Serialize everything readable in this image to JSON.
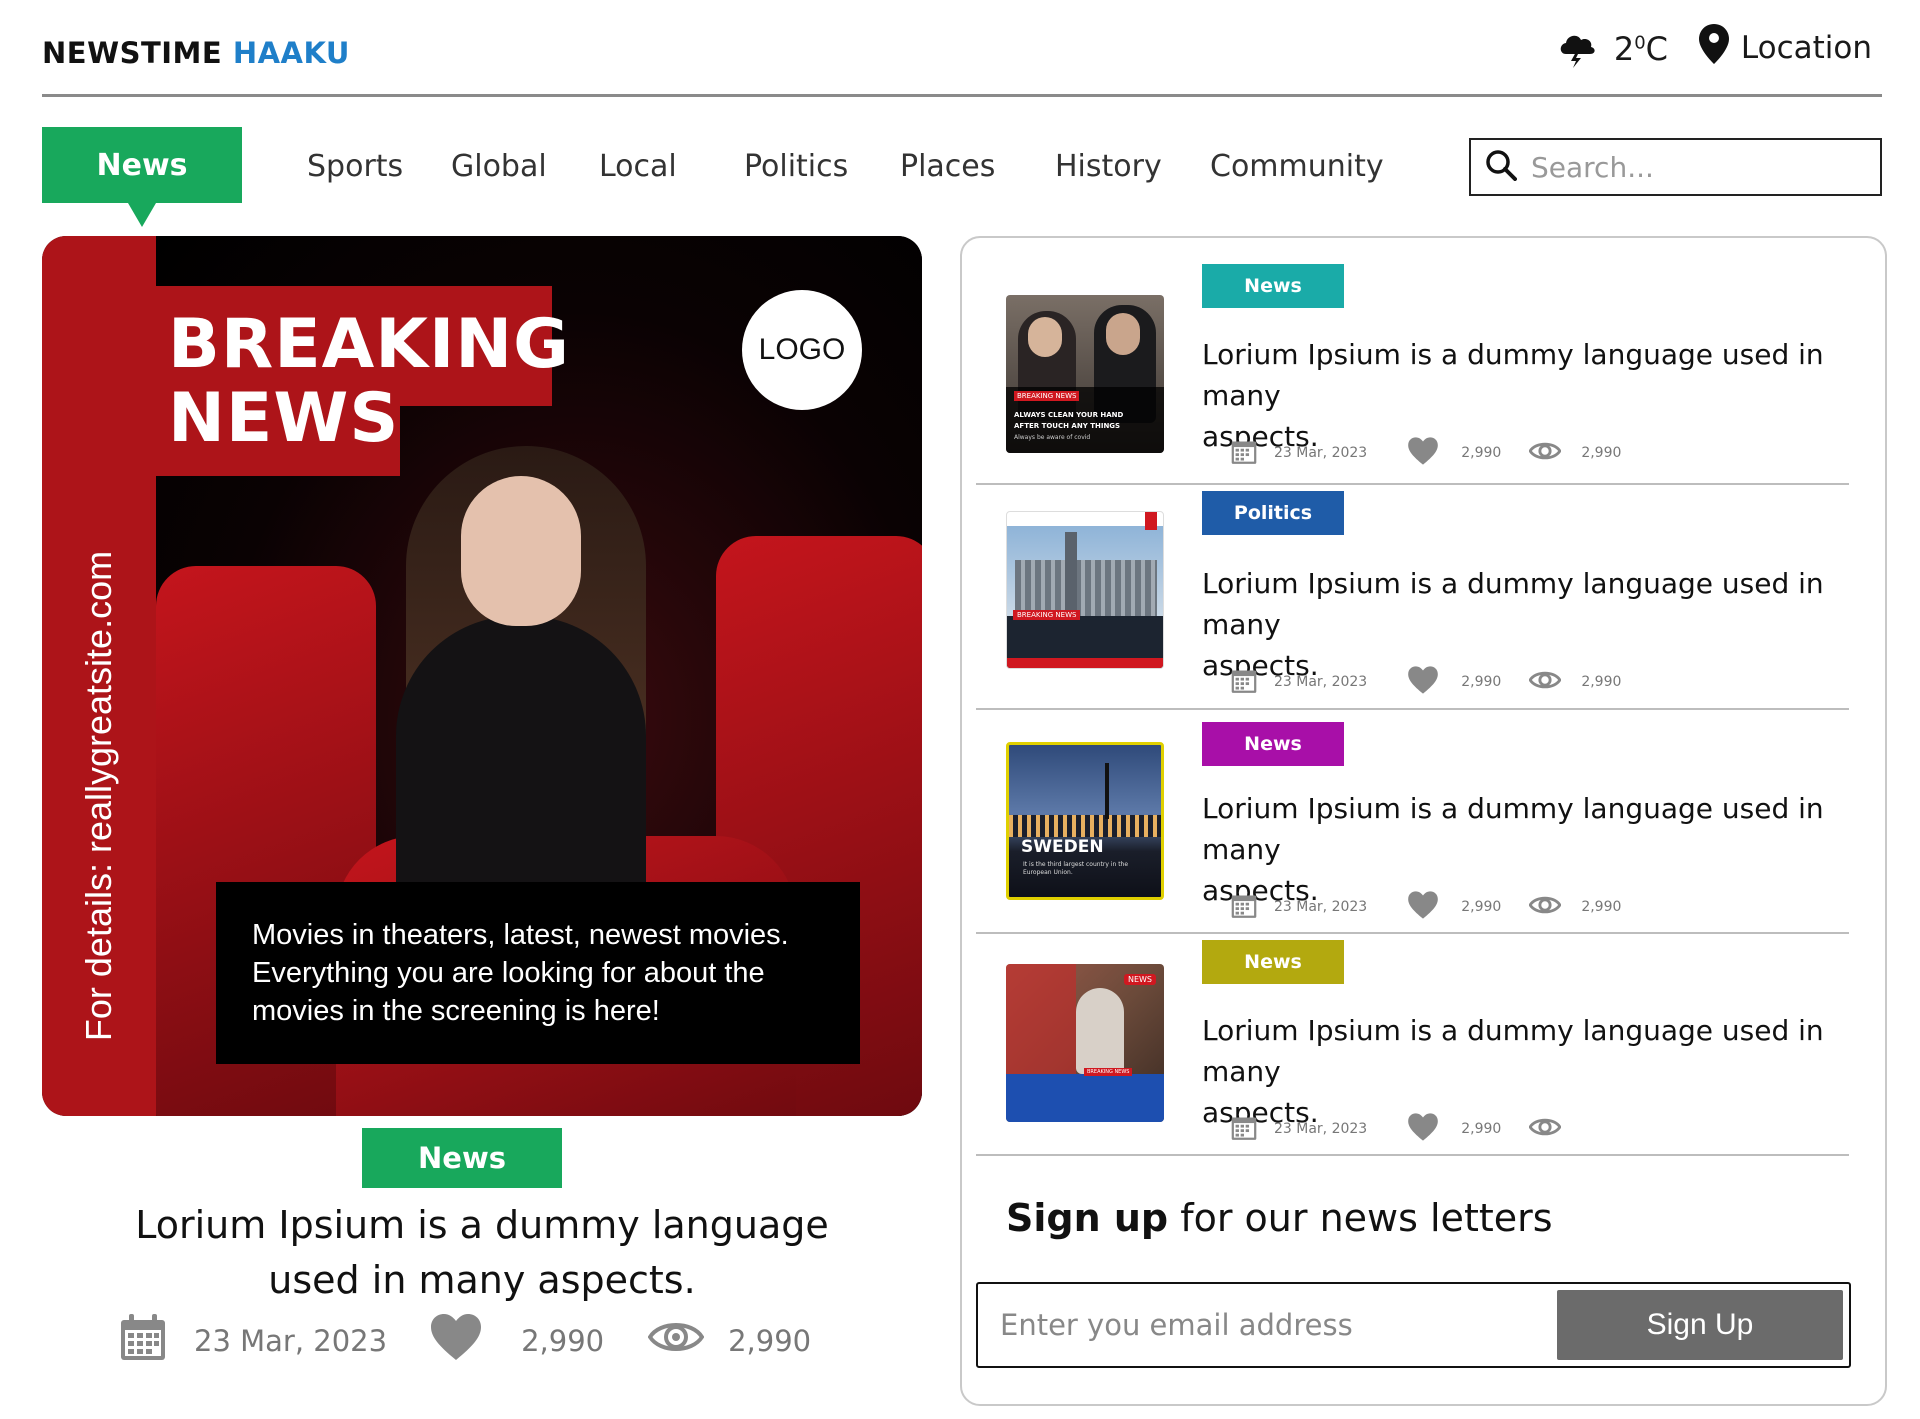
{
  "brand": {
    "part1": "NEWSTIME",
    "part2": "HAAKU"
  },
  "weather": {
    "icon": "storm-cloud-icon",
    "temp_value": "2",
    "temp_degree": "0",
    "temp_unit": "C"
  },
  "location": {
    "icon": "map-pin-icon",
    "label": "Location"
  },
  "nav": {
    "active": "News",
    "items": [
      "Sports",
      "Global",
      "Local",
      "Politics",
      "Places",
      "History",
      "Community"
    ]
  },
  "search": {
    "placeholder": "Search..."
  },
  "hero": {
    "breaking_line1": "BREAKING",
    "breaking_line2": "NEWS",
    "logo": "LOGO",
    "side_text": "For details: reallygreatsite.com",
    "caption": "Movies in theaters, latest, newest movies. Everything you are looking for about the movies in the screening is here!",
    "tag": "News",
    "title_line1": "Lorium Ipsium is a dummy language",
    "title_line2": "used in many aspects.",
    "date": "23 Mar, 2023",
    "likes": "2,990",
    "views": "2,990"
  },
  "articles": [
    {
      "tag": "News",
      "tag_color": "#1aaba8",
      "title_line1": "Lorium Ipsium is a dummy language used in many",
      "title_line2": "aspects.",
      "date": "23 Mar, 2023",
      "likes": "2,990",
      "views": "2,990",
      "thumb": {
        "badge": "BREAKING NEWS",
        "line1": "ALWAYS CLEAN YOUR HAND",
        "line2": "AFTER TOUCH ANY THINGS",
        "line3": "Always be aware of covid"
      }
    },
    {
      "tag": "Politics",
      "tag_color": "#1f5ca8",
      "title_line1": "Lorium Ipsium is a dummy language used in many",
      "title_line2": "aspects.",
      "date": "23 Mar, 2023",
      "likes": "2,990",
      "views": "2,990",
      "thumb": {
        "badge": "BREAKING NEWS"
      }
    },
    {
      "tag": "News",
      "tag_color": "#a80fa8",
      "title_line1": "Lorium Ipsium is a dummy language used in many",
      "title_line2": "aspects.",
      "date": "23 Mar, 2023",
      "likes": "2,990",
      "views": "2,990",
      "thumb": {
        "heading": "SWEDEN",
        "sub": "It is the third largest country in the European Union."
      }
    },
    {
      "tag": "News",
      "tag_color": "#b3a90f",
      "title_line1": "Lorium Ipsium is a dummy language used in many",
      "title_line2": "aspects.",
      "date": "23 Mar, 2023",
      "likes": "2,990",
      "views": "",
      "thumb": {
        "badge": "NEWS",
        "sub_badge": "BREAKING NEWS"
      }
    }
  ],
  "signup": {
    "title_bold": "Sign up",
    "title_rest": " for our news letters",
    "placeholder": "Enter you email address",
    "button": "Sign Up"
  },
  "colors": {
    "green": "#18a85c",
    "red": "#ad1419",
    "blue": "#1f7fc9",
    "grey_button": "#6b6b6b"
  }
}
